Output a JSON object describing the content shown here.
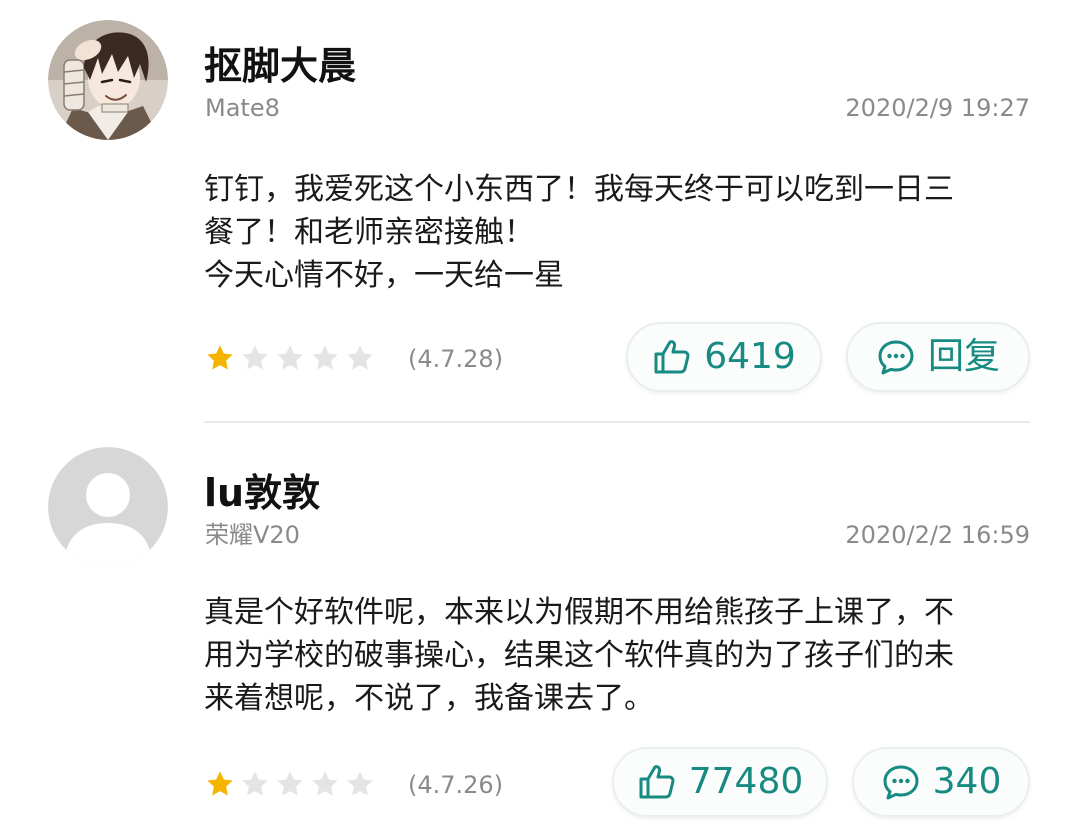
{
  "colors": {
    "accent": "#178a82",
    "star_filled": "#f4b400",
    "star_empty": "#e4e4e4",
    "meta_text": "#8a8a8a"
  },
  "reviews": [
    {
      "username": "抠脚大晨",
      "device": "Mate8",
      "timestamp": "2020/2/9 19:27",
      "comment_lines": [
        "钉钉，我爱死这个小东西了！我每天终于可以吃到一日三",
        "餐了！和老师亲密接触！",
        "今天心情不好，一天给一星"
      ],
      "rating": 1,
      "max_rating": 5,
      "version": "(4.7.28)",
      "like_count": "6419",
      "like_icon": "thumbs-up-icon",
      "reply_label": "回复",
      "reply_icon": "comment-bubble-icon",
      "avatar_icon": "anime-character-avatar"
    },
    {
      "username": "lu敦敦",
      "device": "荣耀V20",
      "timestamp": "2020/2/2 16:59",
      "comment_lines": [
        "真是个好软件呢，本来以为假期不用给熊孩子上课了，不",
        "用为学校的破事操心，结果这个软件真的为了孩子们的未",
        "来着想呢，不说了，我备课去了。"
      ],
      "rating": 1,
      "max_rating": 5,
      "version": "(4.7.26)",
      "like_count": "77480",
      "like_icon": "thumbs-up-icon",
      "reply_count": "340",
      "reply_icon": "comment-bubble-icon",
      "avatar_icon": "default-user-avatar"
    }
  ]
}
